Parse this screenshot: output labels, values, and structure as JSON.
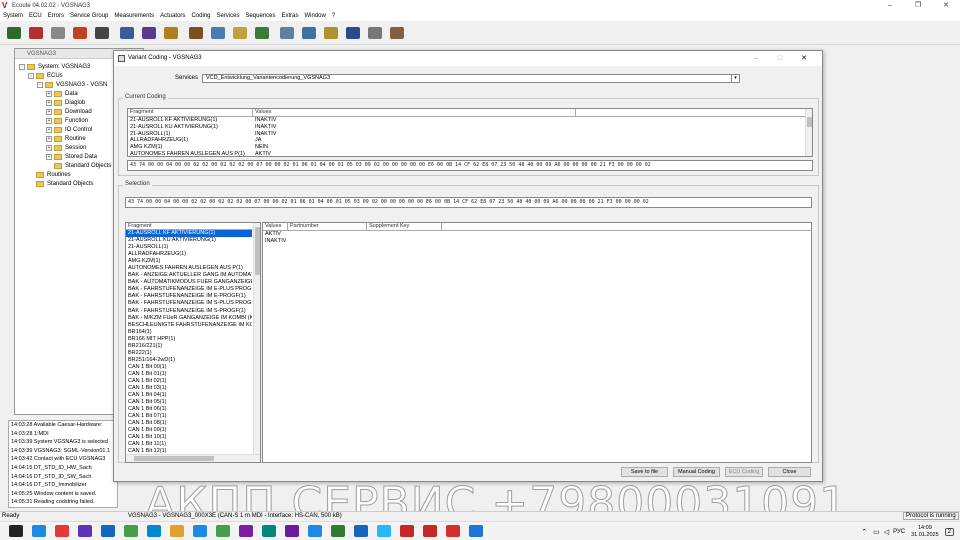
{
  "app": {
    "title": "Ecoute 04.02.02 - VGSNAG3",
    "menu": [
      "System",
      "ECU",
      "Errors",
      "Service Group",
      "Measurements",
      "Actuators",
      "Coding",
      "Services",
      "Sequences",
      "Extras",
      "Window",
      "?"
    ]
  },
  "tree_window": {
    "title": "VGSNAG3",
    "nodes": [
      {
        "label": "System: VGSNAG3",
        "level": 0,
        "toggle": "-"
      },
      {
        "label": "ECUs",
        "level": 1,
        "toggle": "-"
      },
      {
        "label": "VGSNAG3 - VGSN",
        "level": 2,
        "toggle": "-"
      },
      {
        "label": "Data",
        "level": 3,
        "toggle": "+"
      },
      {
        "label": "Diaglob",
        "level": 3,
        "toggle": "+"
      },
      {
        "label": "Download",
        "level": 3,
        "toggle": "+"
      },
      {
        "label": "Function",
        "level": 3,
        "toggle": "+"
      },
      {
        "label": "IO Control",
        "level": 3,
        "toggle": "+"
      },
      {
        "label": "Routine",
        "level": 3,
        "toggle": "+"
      },
      {
        "label": "Session",
        "level": 3,
        "toggle": "+"
      },
      {
        "label": "Stored Data",
        "level": 3,
        "toggle": "+"
      },
      {
        "label": "Standard Objects",
        "level": 3,
        "toggle": ""
      },
      {
        "label": "Routines",
        "level": 1,
        "toggle": ""
      },
      {
        "label": "Standard Objects",
        "level": 1,
        "toggle": ""
      }
    ]
  },
  "log": [
    "14:03:28 Available Caesar-Hardware:",
    "14:03:28 1:MDI",
    "14:03:39 System VGSNAG3 is selected",
    "14:03:39 VGSNAG3: SGML-Version01.1",
    "14:03:42 Contact with ECU VGSNAG3",
    "    14:04:15 DT_STD_ID_HW_Sach",
    "    14:04:16 DT_STD_ID_SW_Sach",
    "    14:04:16 DT_STD_Immobilizer",
    "14:05:25 Window content is saved.",
    "    14:05:31 Reading codstring failed."
  ],
  "status": {
    "left": "Ready",
    "middle": "VGSNAG3 - VGSNAG3_000X3E (CAN-S 1 m MDI - Interface: HS-CAN, 500 kB)",
    "right": "Protocol is running"
  },
  "watermark": "АКПП СЕРВИС +79800031091",
  "taskbar": {
    "time": "14:09",
    "date": "31.01.2025",
    "lang": "РУС",
    "notifications": "2"
  },
  "dialog": {
    "title": "Variant Coding - VGSNAG3",
    "services_label": "Services",
    "services_value": "VCD_Entwicklung_Variantencodierung_VGSNAG3",
    "current_coding_label": "Current Coding",
    "current_headers": [
      "Fragment",
      "Values"
    ],
    "current_rows": [
      [
        "21-AUSROLL KF AKTIVIERUNG(1)",
        "INAKTIV"
      ],
      [
        "21-AUSROLL KU AKTIVIERUNG(1)",
        "INAKTIV"
      ],
      [
        "21-AUSROLL(1)",
        "INAKTIV"
      ],
      [
        "ALLRADFAHRZEUG(1)",
        "JA"
      ],
      [
        "AMG KZM(1)",
        "NEIN"
      ],
      [
        "AUTONOMES FAHREN AUSLEGEN AUS P(1)",
        "AKTIV"
      ]
    ],
    "current_hex": "43 74 00 00 04 00 00 02 02 00 02 02 02 00 07 00 00 02 01 06 01 04 00 01 05 03 09 02 00 00 00 00 00 E6 00 0B 14 CF 62 E8 07 23 50 48 40 00 09 A6 00 00 00 00 21 F3 00 00 00 02",
    "selection_label": "Selection",
    "selection_hex": "43 74 00 00 04 00 00 02 02 00 02 02 02 00 07 00 00 02 01 06 01 04 00 01 05 03 09 02 00 00 00 00 00 E6 00 0B 14 CF 62 E8 07 23 50 48 40 00 09 A6 00 00 00 00 21 F3 00 00 00 02",
    "fragment_header": "Fragment",
    "fragments": [
      "21-AUSROLL KF AKTIVIERUNG(1)",
      "21-AUSROLL KU AKTIVIERUNG(1)",
      "21-AUSROLL(1)",
      "ALLRADFAHRZEUG(1)",
      "AMG KZM(1)",
      "AUTONOMES FAHREN AUSLEGEN AUS P(1)",
      "BAK - ANZEIGE AKTUELLER GANG IM AUTOMAT",
      "BAK - AUTOMATIKMODUS FUER GANGANZEIGE",
      "BAK - FAHRSTUFENANZEIGE IM E-PLUS PROGF",
      "BAK - FAHRSTUFENANZEIGE IM E-PROGF(1)",
      "BAK - FAHRSTUFENANZEIGE IM S-PLUS PROGF",
      "BAK - FAHRSTUFENANZEIGE IM S-PROGF(1)",
      "BAK - M/KZM FUeR GANGANZEIGE IM KOMBI (K",
      "BESCHLEUNIGTE FAHRSTUFENANZEIGE IM KO",
      "BR164(1)",
      "BR166 MIT HPP(1)",
      "BR216/221(1)",
      "BR222(1)",
      "BR251/164-2wD(1)",
      "CAN 1 Bit 00(1)",
      "CAN 1 Bit 01(1)",
      "CAN 1 Bit 02(1)",
      "CAN 1 Bit 03(1)",
      "CAN 1 Bit 04(1)",
      "CAN 1 Bit 05(1)",
      "CAN 1 Bit 06(1)",
      "CAN 1 Bit 07(1)",
      "CAN 1 Bit 08(1)",
      "CAN 1 Bit 09(1)",
      "CAN 1 Bit 10(1)",
      "CAN 1 Bit 11(1)",
      "CAN 1 Bit 12(1)"
    ],
    "value_headers": [
      "Values",
      "Partnumber",
      "Supplement Key"
    ],
    "values": [
      "AKTIV",
      "INAKTIV"
    ],
    "buttons": {
      "save": "Save to file",
      "manual": "Manual Coding",
      "ecu": "ECU Coding",
      "close": "Close"
    }
  },
  "colors": {
    "selection": "#0a64d8",
    "logo_red": "#c00000"
  }
}
